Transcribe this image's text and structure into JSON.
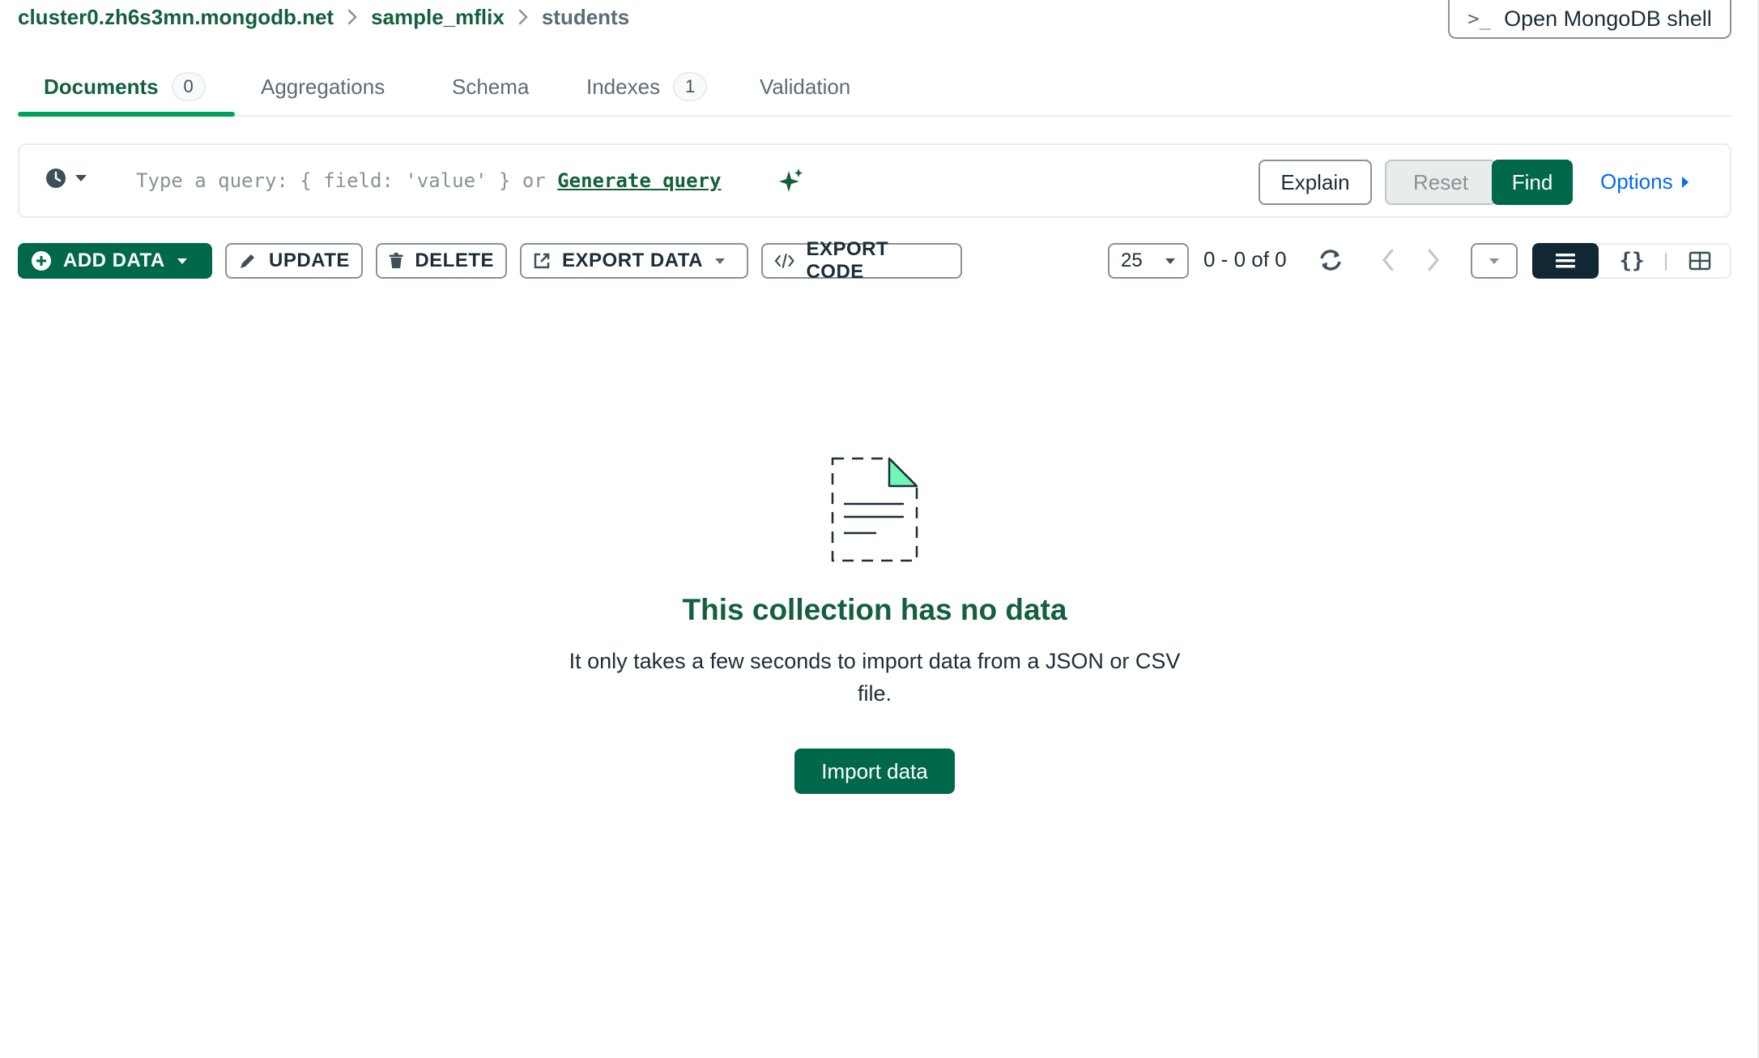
{
  "breadcrumb": {
    "cluster": "cluster0.zh6s3mn.mongodb.net",
    "database": "sample_mflix",
    "collection": "students"
  },
  "shell_button": {
    "icon_text": ">_",
    "label": "Open MongoDB shell"
  },
  "tabs": [
    {
      "label": "Documents",
      "count": "0",
      "active": true
    },
    {
      "label": "Aggregations"
    },
    {
      "label": "Schema"
    },
    {
      "label": "Indexes",
      "count": "1"
    },
    {
      "label": "Validation"
    }
  ],
  "query": {
    "placeholder_text": "Type a query: { field: 'value' } or ",
    "generate_label": "Generate query",
    "explain_label": "Explain",
    "reset_label": "Reset",
    "find_label": "Find",
    "options_label": "Options"
  },
  "toolbar": {
    "add_data": "ADD DATA",
    "update": "UPDATE",
    "delete": "DELETE",
    "export_data": "EXPORT DATA",
    "export_code": "EXPORT CODE",
    "page_size": "25",
    "range": "0 - 0 of 0",
    "json_view_glyph": "{}"
  },
  "empty_state": {
    "title": "This collection has no data",
    "description": "It only takes a few seconds to import data from a JSON or CSV file.",
    "import_label": "Import data"
  },
  "colors": {
    "brand_green": "#00684a",
    "heading_green": "#13603d",
    "tab_accent": "#00a35c",
    "link_blue": "#016bf8",
    "illustration_fill": "#71f6ba"
  }
}
